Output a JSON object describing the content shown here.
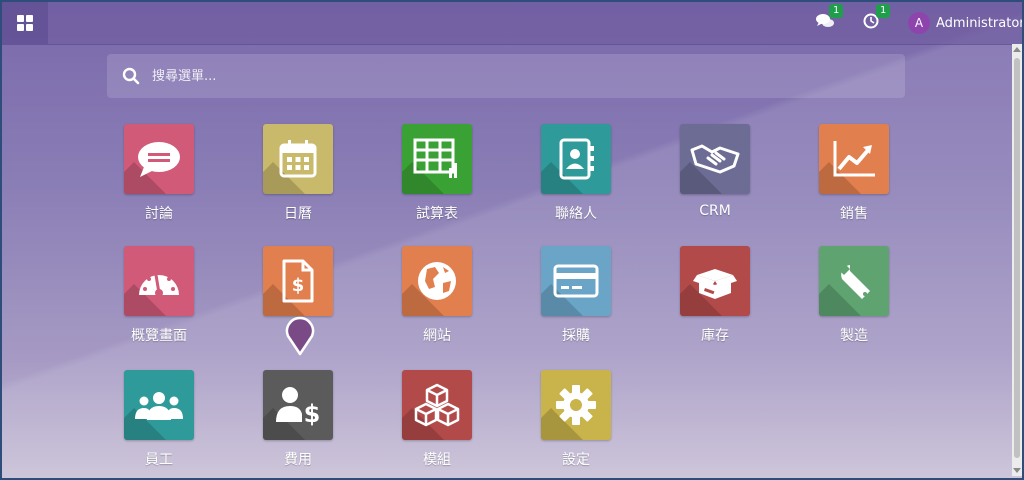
{
  "topbar": {
    "messages_badge": "1",
    "activities_badge": "1",
    "user_initial": "A",
    "user_name": "Administrator"
  },
  "search": {
    "placeholder": "搜尋選單..."
  },
  "apps": [
    {
      "label": "討論",
      "color": "#d05a78"
    },
    {
      "label": "日曆",
      "color": "#c9b96b"
    },
    {
      "label": "試算表",
      "color": "#3aa135"
    },
    {
      "label": "聯絡人",
      "color": "#2f9a9a"
    },
    {
      "label": "CRM",
      "color": "#6c6c94"
    },
    {
      "label": "銷售",
      "color": "#e27f4e"
    },
    {
      "label": "概覽畫面",
      "color": "#d05a78"
    },
    {
      "label": "",
      "color": "#e27f4e"
    },
    {
      "label": "網站",
      "color": "#e27f4e"
    },
    {
      "label": "採購",
      "color": "#6aa5c8"
    },
    {
      "label": "庫存",
      "color": "#b34a4a"
    },
    {
      "label": "製造",
      "color": "#5ea370"
    },
    {
      "label": "員工",
      "color": "#2f9a9a"
    },
    {
      "label": "費用",
      "color": "#5b5b5b"
    },
    {
      "label": "模組",
      "color": "#b34a4a"
    },
    {
      "label": "設定",
      "color": "#c9b34b"
    }
  ]
}
